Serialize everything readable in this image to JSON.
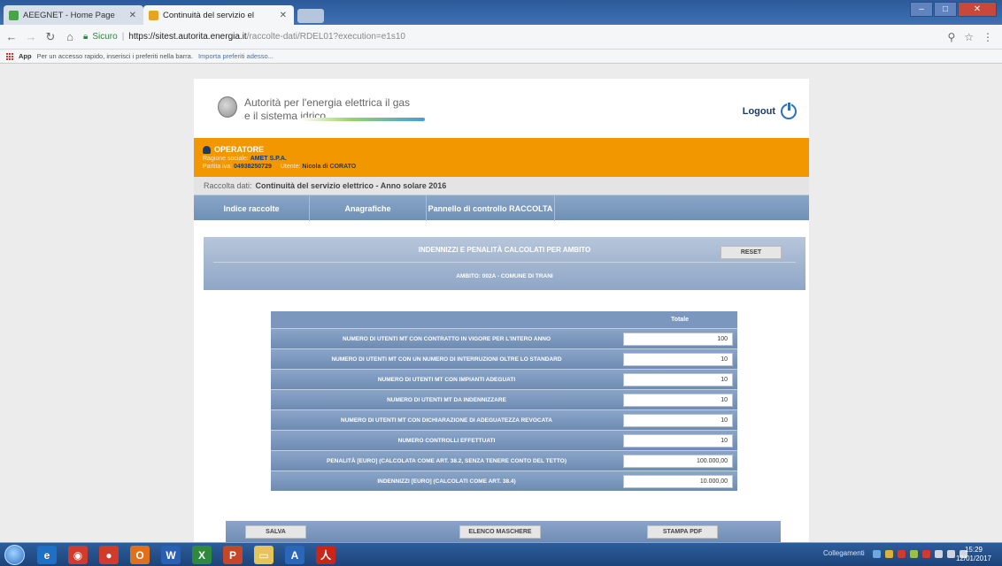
{
  "browser": {
    "tabs": [
      {
        "title": "AEEGNET - Home Page",
        "active": false
      },
      {
        "title": "Continuità del servizio el",
        "active": true
      }
    ],
    "url": {
      "secure_label": "Sicuro",
      "domain": "https://sitest.autorita.energia.it",
      "path": "/raccolte-dati/RDEL01?execution=e1s10"
    },
    "bookmarks": {
      "apps_label": "App",
      "hint": "Per un accesso rapido, inserisci i preferiti nella barra.",
      "import_link": "Importa preferiti adesso..."
    }
  },
  "header": {
    "org_line1": "Autorità per l'energia elettrica il gas",
    "org_line2": "e il sistema idrico",
    "logout_label": "Logout"
  },
  "operator": {
    "title": "OPERATORE",
    "ragione_label": "Ragione sociale:",
    "ragione_value": "AMET S.P.A.",
    "piva_label": "Partita iva:",
    "piva_value": "04938250729",
    "utente_label": "Utente:",
    "utente_value": "Nicola di CORATO"
  },
  "raccolta": {
    "label": "Raccolta dati:",
    "value": "Continuità del servizio elettrico - Anno solare 2016"
  },
  "menu": [
    {
      "label": "Indice raccolte"
    },
    {
      "label": "Anagrafiche"
    },
    {
      "label": "Pannello di controllo RACCOLTA"
    }
  ],
  "section": {
    "title": "INDENNIZZI E PENALITÀ CALCOLATI PER AMBITO",
    "reset_label": "RESET",
    "ambito": "AMBITO: 002A - COMUNE DI TRANI"
  },
  "table": {
    "column_header": "Totale",
    "rows": [
      {
        "label": "NUMERO DI UTENTI MT CON CONTRATTO IN VIGORE PER L'INTERO ANNO",
        "value": "100"
      },
      {
        "label": "NUMERO DI UTENTI MT CON UN NUMERO DI INTERRUZIONI OLTRE LO STANDARD",
        "value": "10"
      },
      {
        "label": "NUMERO DI UTENTI MT CON IMPIANTI ADEGUATI",
        "value": "10"
      },
      {
        "label": "NUMERO DI UTENTI MT DA INDENNIZZARE",
        "value": "10"
      },
      {
        "label": "NUMERO DI UTENTI MT CON DICHIARAZIONE DI ADEGUATEZZA REVOCATA",
        "value": "10"
      },
      {
        "label": "NUMERO CONTROLLI EFFETTUATI",
        "value": "10"
      },
      {
        "label": "PENALITÀ [EURO] (CALCOLATA COME ART. 38.2, SENZA TENERE CONTO DEL TETTO)",
        "value": "100.000,00"
      },
      {
        "label": "INDENNIZZI [EURO] (CALCOLATI COME ART. 38.4)",
        "value": "10.000,00"
      }
    ]
  },
  "footer": {
    "save_label": "SALVA",
    "masks_label": "ELENCO MASCHERE",
    "print_label": "STAMPA PDF"
  },
  "taskbar": {
    "tray_label": "Collegamenti",
    "time": "15:29",
    "date": "12/01/2017"
  },
  "colors": {
    "operator_bg": "#f39700",
    "nav_blue": "#7b97be"
  }
}
